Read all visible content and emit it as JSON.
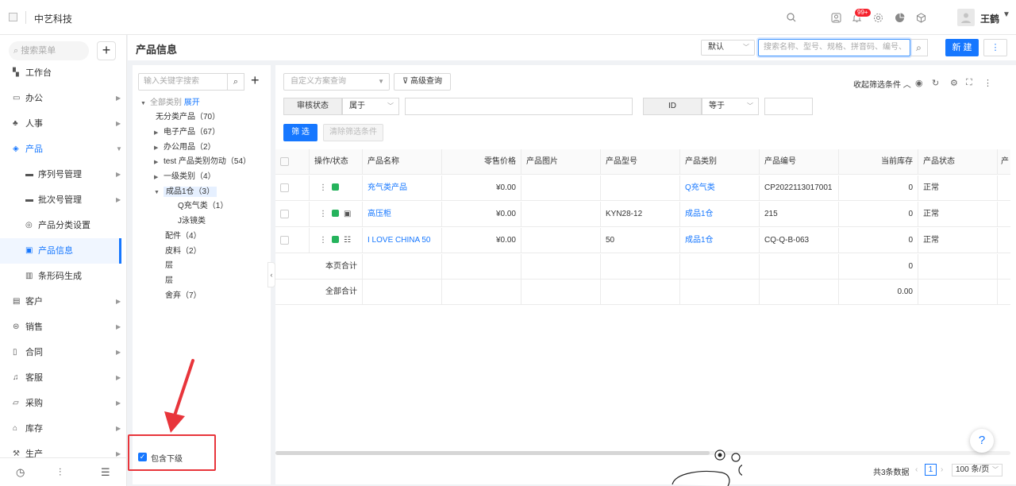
{
  "header": {
    "brand": "中艺科技",
    "badge": "99+",
    "user_name": "王鹤"
  },
  "sidebar": {
    "search_placeholder": "搜索菜单",
    "add": "+",
    "items": [
      {
        "label": "工作台",
        "icon": "dashboard-icon"
      },
      {
        "label": "办公",
        "icon": "office-icon"
      },
      {
        "label": "人事",
        "icon": "people-icon"
      },
      {
        "label": "产品",
        "icon": "product-icon"
      },
      {
        "label": "序列号管理",
        "icon": "folder-icon"
      },
      {
        "label": "批次号管理",
        "icon": "folder-icon"
      },
      {
        "label": "产品分类设置",
        "icon": "settings-icon"
      },
      {
        "label": "产品信息",
        "icon": "info-icon"
      },
      {
        "label": "条形码生成",
        "icon": "barcode-icon"
      },
      {
        "label": "客户",
        "icon": "customer-icon"
      },
      {
        "label": "销售",
        "icon": "sales-icon"
      },
      {
        "label": "合同",
        "icon": "contract-icon"
      },
      {
        "label": "客服",
        "icon": "service-icon"
      },
      {
        "label": "采购",
        "icon": "purchase-icon"
      },
      {
        "label": "库存",
        "icon": "inventory-icon"
      },
      {
        "label": "生产",
        "icon": "production-icon"
      }
    ]
  },
  "page": {
    "title": "产品信息",
    "default_select": "默认",
    "search_placeholder": "搜索名称、型号、规格、拼音码、编号、",
    "new_button": "新 建",
    "more_button": "⋮"
  },
  "tree": {
    "search_placeholder": "输入关键字搜索",
    "root_label": "全部类别",
    "expand_label": "展开",
    "nodes": [
      "无分类产品（70）",
      "电子产品（67）",
      "办公用品（2）",
      "test 产品类别勿动（54）",
      "一级类别（4）",
      "成品1仓（3）",
      "Q充气类（1）",
      "J泳镜类",
      "配件（4）",
      "皮料（2）",
      "层",
      "层",
      "舍弃（7）"
    ],
    "include_children": "包含下级"
  },
  "filters": {
    "scheme_placeholder": "自定义方案查询",
    "advanced": "高级查询",
    "collapse": "收起筛选条件",
    "audit_label": "审核状态",
    "audit_op": "属于",
    "id_label": "ID",
    "id_op": "等于",
    "filter_button": "筛 选",
    "clear_button": "清除筛选条件"
  },
  "table": {
    "columns": [
      "操作/状态",
      "产品名称",
      "零售价格",
      "产品图片",
      "产品型号",
      "产品类别",
      "产品编号",
      "当前库存",
      "产品状态",
      "产"
    ],
    "rows": [
      {
        "name": "充气类产品",
        "price": "¥0.00",
        "image": "",
        "model": "",
        "category": "Q充气类",
        "code": "CP2022113017001",
        "stock": "0",
        "status": "正常"
      },
      {
        "name": "高压柜",
        "price": "¥0.00",
        "image": "",
        "model": "KYN28-12",
        "category": "成品1仓",
        "code": "215",
        "stock": "0",
        "status": "正常"
      },
      {
        "name": "I LOVE CHINA 50",
        "price": "¥0.00",
        "image": "",
        "model": "50",
        "category": "成品1仓",
        "code": "CQ-Q-B-063",
        "stock": "0",
        "status": "正常"
      }
    ],
    "page_total_label": "本页合计",
    "page_total_value": "0",
    "all_total_label": "全部合计",
    "all_total_value": "0.00"
  },
  "pager": {
    "total": "共3条数据",
    "prev": "‹",
    "current": "1",
    "next": "›",
    "size": "100 条/页"
  },
  "help": "?",
  "colors": {
    "accent": "#1677ff",
    "status_ok": "#25b35c",
    "badge": "#f5222d",
    "highlight": "#e8353b"
  }
}
